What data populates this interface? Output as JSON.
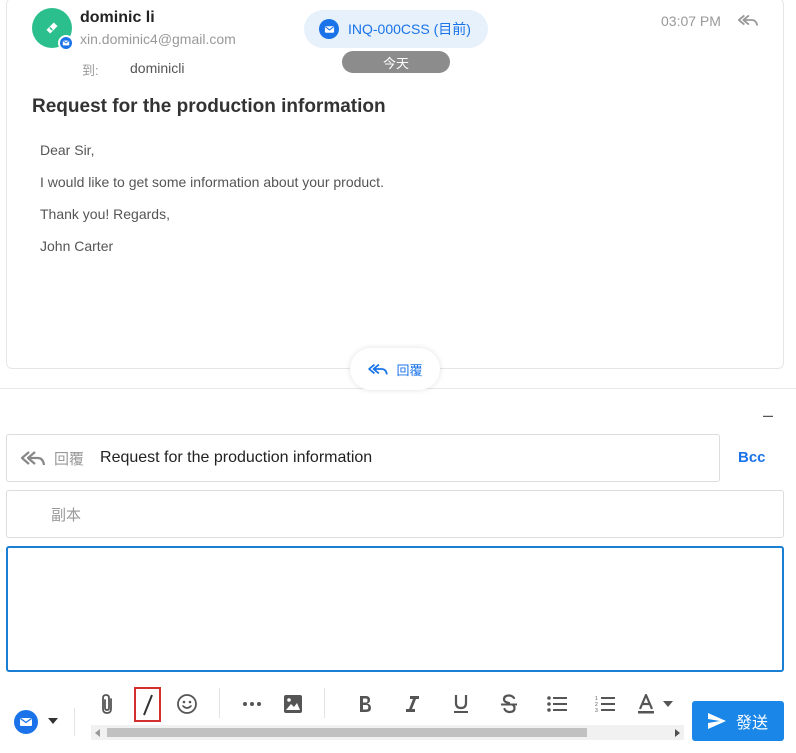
{
  "email": {
    "sender_name": "dominic li",
    "sender_email": "xin.dominic4@gmail.com",
    "to_label": "到:",
    "to_value": "dominicli",
    "inquiry_tag": "INQ-000CSS (目前)",
    "date_pill": "今天",
    "time": "03:07 PM",
    "subject": "Request for the production information",
    "body": [
      "Dear Sir,",
      "I would like to get some information about your product.",
      "Thank you! Regards,",
      "John Carter"
    ],
    "reply_button_label": "回覆"
  },
  "compose": {
    "reply_label": "回覆",
    "subject_value": "Request for the production information",
    "bcc_label": "Bcc",
    "cc_placeholder": "副本",
    "body_value": "",
    "minimize_label": "–",
    "send_label": "發送"
  },
  "toolbar": {
    "icons": [
      "mail-icon",
      "attach-icon",
      "slash-icon",
      "emoji-icon",
      "more-icon",
      "image-icon",
      "bold-icon",
      "italic-icon",
      "underline-icon",
      "strikethrough-icon",
      "bullet-list-icon",
      "numbered-list-icon",
      "font-color-icon"
    ]
  },
  "colors": {
    "accent": "#1a73e8",
    "avatar": "#2bbf8e",
    "send_button": "#1a86e8",
    "highlight_box": "#d32f2f",
    "date_pill": "#8c8c8c"
  }
}
